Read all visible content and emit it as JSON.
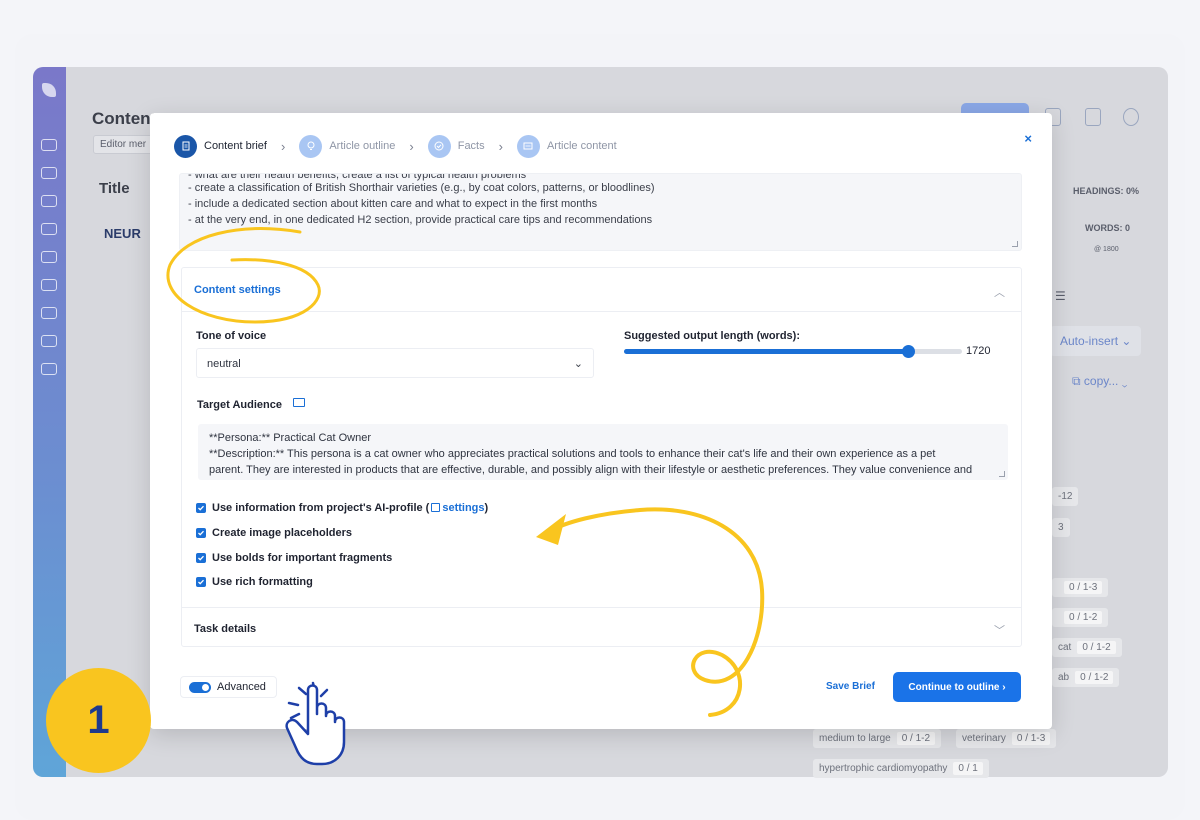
{
  "background_app": {
    "page_title": "Content",
    "editor_chip": "Editor mer",
    "title_label": "Title",
    "brand": "NEUR",
    "headings": "HEADINGS: 0%",
    "words": "WORDS: 0",
    "words_target": "@ 1800",
    "auto_insert": "Auto-insert",
    "copy": "copy...",
    "pills": [
      {
        "label": "",
        "count": "0 / 1-3"
      },
      {
        "label": "",
        "count": "0 / 1-2"
      },
      {
        "label": "cat",
        "count": "0 / 1-2"
      },
      {
        "label": "ab",
        "count": "0 / 1-2"
      },
      {
        "label": "medium to large",
        "count": "0 / 1-2"
      },
      {
        "label": "veterinary",
        "count": "0 / 1-3"
      },
      {
        "label": "hypertrophic cardiomyopathy",
        "count": "0 / 1"
      }
    ],
    "side_nums": [
      "-12",
      "3"
    ]
  },
  "steps": [
    {
      "label": "Content brief",
      "active": true
    },
    {
      "label": "Article outline",
      "active": false
    },
    {
      "label": "Facts",
      "active": false
    },
    {
      "label": "Article content",
      "active": false
    }
  ],
  "close_label": "×",
  "brief_lines": [
    "- what are their health benefits, create a list of typical health problems",
    "- create a classification of British Shorthair varieties (e.g., by coat colors, patterns, or bloodlines)",
    "- include a dedicated section about kitten care and what to expect in the first months",
    "- at the very end, in one dedicated H2 section, provide practical care tips and recommendations"
  ],
  "content_settings": {
    "title": "Content settings",
    "tone_label": "Tone of voice",
    "tone_value": "neutral",
    "length_label": "Suggested output length (words):",
    "length_value": "1720",
    "length_fraction": 0.84,
    "audience_label": "Target Audience",
    "audience_lines": [
      "**Persona:** Practical Cat Owner",
      "**Description:** This persona is a cat owner who appreciates practical solutions and tools to enhance their cat's life and their own experience as a pet",
      "parent. They are interested in products that are effective, durable, and possibly align with their lifestyle or aesthetic preferences. They value convenience and"
    ],
    "checkboxes": {
      "ai_profile_prefix": "Use information from project's AI-profile (",
      "ai_profile_link": "settings",
      "ai_profile_suffix": ")",
      "image_placeholders": "Create image placeholders",
      "bolds": "Use bolds for important fragments",
      "rich_formatting": "Use rich formatting"
    }
  },
  "task_details": "Task details",
  "footer": {
    "advanced": "Advanced",
    "save_brief": "Save Brief",
    "continue": "Continue to outline ›"
  },
  "step_badge": "1",
  "colors": {
    "accent": "#1a73e8",
    "annotation": "#f9c51f",
    "badge_text": "#1f3a8c"
  }
}
